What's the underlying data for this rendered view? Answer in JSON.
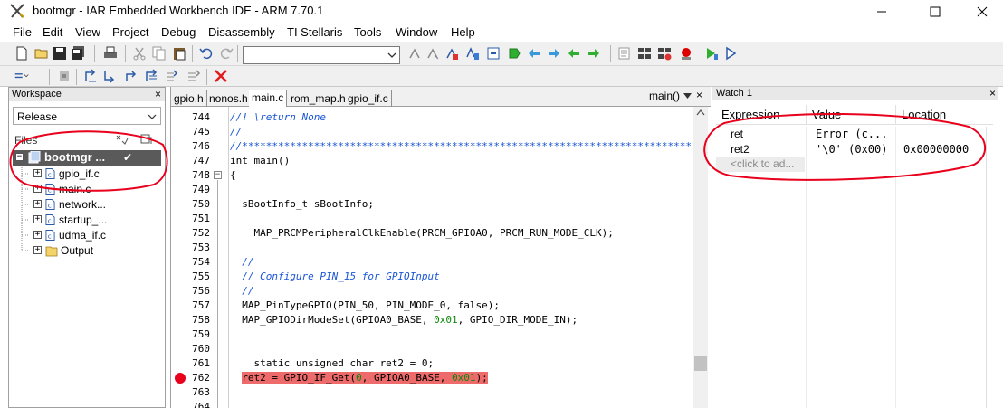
{
  "window": {
    "title": "bootmgr - IAR Embedded Workbench IDE - ARM 7.70.1"
  },
  "menu": {
    "items": [
      "File",
      "Edit",
      "View",
      "Project",
      "Debug",
      "Disassembly",
      "TI Stellaris",
      "Tools",
      "Window",
      "Help"
    ]
  },
  "toolbar": {
    "find_value": ""
  },
  "workspace": {
    "title": "Workspace",
    "close": "×",
    "configuration": "Release",
    "files_label": "Files",
    "project": "bootmgr ...",
    "project_check": "✔",
    "items": [
      {
        "label": "gpio_if.c",
        "expander": "+",
        "type": "file"
      },
      {
        "label": "main.c",
        "expander": "+",
        "type": "file"
      },
      {
        "label": "network...",
        "expander": "+",
        "type": "file"
      },
      {
        "label": "startup_...",
        "expander": "+",
        "type": "file"
      },
      {
        "label": "udma_if.c",
        "expander": "+",
        "type": "file"
      },
      {
        "label": "Output",
        "expander": "+",
        "type": "folder"
      }
    ]
  },
  "editor": {
    "tabs": [
      {
        "label": "gpio.h",
        "active": false
      },
      {
        "label": "nonos.h",
        "active": false
      },
      {
        "label": "main.c",
        "active": true
      },
      {
        "label": "rom_map.h",
        "active": false
      },
      {
        "label": "gpio_if.c",
        "active": false
      }
    ],
    "function_dropdown": "main()",
    "close": "×",
    "lines": [
      {
        "num": "744",
        "html": "<span class=\"cm\">//! \\return None</span>"
      },
      {
        "num": "745",
        "html": "<span class=\"cm\">//</span>"
      },
      {
        "num": "746",
        "html": "<span class=\"cm\">//*****************************************************************************</span>"
      },
      {
        "num": "747",
        "html": "int main()"
      },
      {
        "num": "748",
        "html": "{"
      },
      {
        "num": "749",
        "html": ""
      },
      {
        "num": "750",
        "html": "  sBootInfo_t sBootInfo;"
      },
      {
        "num": "751",
        "html": ""
      },
      {
        "num": "752",
        "html": "    MAP_PRCMPeripheralClkEnable(PRCM_GPIOA0, PRCM_RUN_MODE_CLK);"
      },
      {
        "num": "753",
        "html": ""
      },
      {
        "num": "754",
        "html": "  <span class=\"cm\">//</span>"
      },
      {
        "num": "755",
        "html": "  <span class=\"cm\">// Configure PIN_15 for GPIOInput</span>"
      },
      {
        "num": "756",
        "html": "  <span class=\"cm\">//</span>"
      },
      {
        "num": "757",
        "html": "  MAP_PinTypeGPIO(PIN_50, PIN_MODE_0, false);"
      },
      {
        "num": "758",
        "html": "  MAP_GPIODirModeSet(GPIOA0_BASE, <span style=\"color:#0a8a0a\">0x01</span>, GPIO_DIR_MODE_IN);"
      },
      {
        "num": "759",
        "html": ""
      },
      {
        "num": "760",
        "html": ""
      },
      {
        "num": "761",
        "html": "    static unsigned char ret2 = 0;"
      },
      {
        "num": "762",
        "html": "  <span class=\"hl\">ret2 = GPIO_IF_Get(<span style=\"color:#0a8a0a\">0</span>, GPIOA0_BASE, <span style=\"color:#0a8a0a\">0x01</span>);</span>"
      },
      {
        "num": "763",
        "html": ""
      },
      {
        "num": "764",
        "html": ""
      }
    ]
  },
  "watch": {
    "title": "Watch 1",
    "close": "×",
    "columns": [
      "Expression",
      "Value",
      "Location"
    ],
    "rows": [
      {
        "expression": "ret",
        "value": "Error (c...",
        "location": ""
      },
      {
        "expression": "ret2",
        "value": "'\\0' (0x00)",
        "location": "0x00000000"
      }
    ],
    "add_placeholder": "<click to ad..."
  },
  "colors": {
    "annotation": "#e8001c",
    "highlight": "#ee6b6b",
    "comment": "#1a56d6",
    "numeric": "#0a8a0a"
  }
}
